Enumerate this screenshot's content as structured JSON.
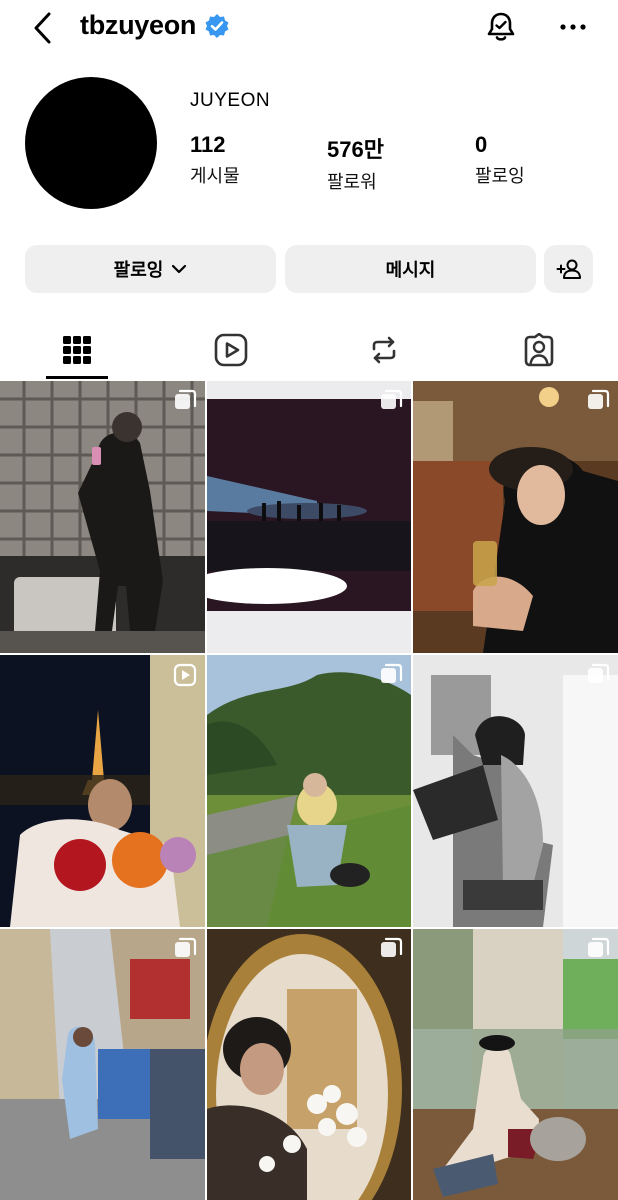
{
  "header": {
    "username": "tbzuyeon",
    "verified": true,
    "icons": [
      "chevron-left-icon",
      "verified-badge-icon",
      "bell-icon",
      "more-horizontal-icon"
    ]
  },
  "profile": {
    "display_name": "JUYEON",
    "stats": {
      "posts": {
        "value": "112",
        "label": "게시물"
      },
      "followers": {
        "value": "576만",
        "label": "팔로워"
      },
      "following": {
        "value": "0",
        "label": "팔로잉"
      }
    }
  },
  "actions": {
    "follow_label": "팔로잉",
    "message_label": "메시지"
  },
  "tabs": [
    {
      "name": "grid",
      "icon": "grid-icon",
      "active": true
    },
    {
      "name": "reels",
      "icon": "reels-icon",
      "active": false
    },
    {
      "name": "reposts",
      "icon": "repost-icon",
      "active": false
    },
    {
      "name": "tagged",
      "icon": "tagged-person-icon",
      "active": false
    }
  ],
  "posts": [
    {
      "description": "mirror selfie in black leather coat, glass block wall",
      "badge": "multi-photo"
    },
    {
      "description": "film photo of dark concert stage",
      "badge": "multi-photo"
    },
    {
      "description": "man in black cap at bar with drink",
      "badge": "multi-photo"
    },
    {
      "description": "eiffel tower at night with bouquet of flowers",
      "badge": "reel"
    },
    {
      "description": "sitting on grass in park",
      "badge": "multi-photo"
    },
    {
      "description": "black and white shirtless photo with bag",
      "badge": "multi-photo"
    },
    {
      "description": "street in paris with blue cart",
      "badge": "multi-photo"
    },
    {
      "description": "reflection in gold mirror with white flowers",
      "badge": "multi-photo"
    },
    {
      "description": "sitting on bench in sailor cap",
      "badge": "multi-photo"
    }
  ],
  "colors": {
    "button_bg": "#efefef",
    "verified_blue": "#3897f0",
    "text": "#000000"
  }
}
